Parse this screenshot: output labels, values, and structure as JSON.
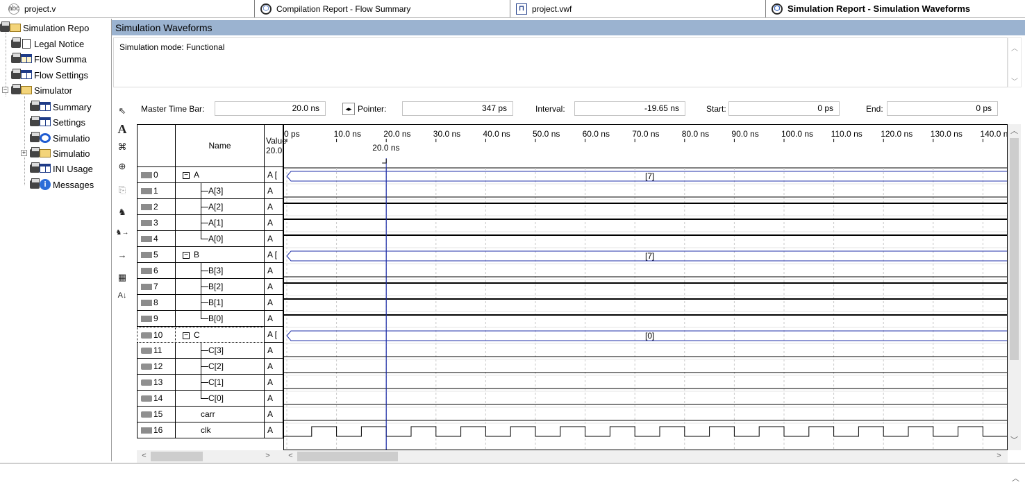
{
  "tabs": [
    {
      "label": "project.v",
      "icon": "abc-file-icon",
      "active": false
    },
    {
      "label": "Compilation Report - Flow Summary",
      "icon": "report-icon",
      "active": false
    },
    {
      "label": "project.vwf",
      "icon": "waveform-file-icon",
      "active": false
    },
    {
      "label": "Simulation Report - Simulation Waveforms",
      "icon": "report-icon",
      "active": true
    }
  ],
  "navigator": {
    "items": [
      {
        "label": "Simulation Repo"
      },
      {
        "label": "Legal Notice"
      },
      {
        "label": "Flow Summa"
      },
      {
        "label": "Flow Settings"
      },
      {
        "label": "Simulator"
      },
      {
        "label": "Summary"
      },
      {
        "label": "Settings"
      },
      {
        "label": "Simulatio"
      },
      {
        "label": "Simulatio"
      },
      {
        "label": "INI Usage"
      },
      {
        "label": "Messages"
      }
    ]
  },
  "panel": {
    "title": "Simulation Waveforms",
    "mode_text": "Simulation mode: Functional"
  },
  "timebar": {
    "master_label": "Master Time Bar:",
    "master_value": "20.0 ns",
    "pointer_label": "Pointer:",
    "pointer_value": "347 ps",
    "interval_label": "Interval:",
    "interval_value": "-19.65 ns",
    "start_label": "Start:",
    "start_value": "0 ps",
    "end_label": "End:",
    "end_value": "0 ps"
  },
  "columns": {
    "name": "Name",
    "value": "Value",
    "value_sub": "20.0"
  },
  "time_axis": {
    "ticks": [
      "0 ps",
      "10.0 ns",
      "20.0 ns",
      "30.0 ns",
      "40.0 ns",
      "50.0 ns",
      "60.0 ns",
      "70.0 ns",
      "80.0 ns",
      "90.0 ns",
      "100.0 ns",
      "110.0 ns",
      "120.0 ns",
      "130.0 ns",
      "140.0 ns"
    ],
    "marker_label": "20.0 ns",
    "marker_time_ns": 20,
    "ns_per_tick": 10
  },
  "signals": [
    {
      "index": "0",
      "name": "A",
      "value": "A [",
      "kind": "in",
      "group": true,
      "wave": "bus",
      "bus_label": "[7]"
    },
    {
      "index": "1",
      "name": "A[3]",
      "value": "A",
      "kind": "in",
      "child": true,
      "wave": "low"
    },
    {
      "index": "2",
      "name": "A[2]",
      "value": "A",
      "kind": "in",
      "child": true,
      "wave": "high"
    },
    {
      "index": "3",
      "name": "A[1]",
      "value": "A",
      "kind": "in",
      "child": true,
      "wave": "high"
    },
    {
      "index": "4",
      "name": "A[0]",
      "value": "A",
      "kind": "in",
      "child": true,
      "last": true,
      "wave": "high"
    },
    {
      "index": "5",
      "name": "B",
      "value": "A [",
      "kind": "in",
      "group": true,
      "wave": "bus",
      "bus_label": "[7]"
    },
    {
      "index": "6",
      "name": "B[3]",
      "value": "A",
      "kind": "in",
      "child": true,
      "wave": "low"
    },
    {
      "index": "7",
      "name": "B[2]",
      "value": "A",
      "kind": "in",
      "child": true,
      "wave": "high"
    },
    {
      "index": "8",
      "name": "B[1]",
      "value": "A",
      "kind": "in",
      "child": true,
      "wave": "high"
    },
    {
      "index": "9",
      "name": "B[0]",
      "value": "A",
      "kind": "in",
      "child": true,
      "last": true,
      "wave": "high"
    },
    {
      "index": "10",
      "name": "C",
      "value": "A [",
      "kind": "out",
      "group": true,
      "wave": "bus",
      "bus_label": "[0]"
    },
    {
      "index": "11",
      "name": "C[3]",
      "value": "A",
      "kind": "out",
      "child": true,
      "wave": "low"
    },
    {
      "index": "12",
      "name": "C[2]",
      "value": "A",
      "kind": "out",
      "child": true,
      "wave": "low"
    },
    {
      "index": "13",
      "name": "C[1]",
      "value": "A",
      "kind": "out",
      "child": true,
      "wave": "low"
    },
    {
      "index": "14",
      "name": "C[0]",
      "value": "A",
      "kind": "out",
      "child": true,
      "last": true,
      "wave": "low"
    },
    {
      "index": "15",
      "name": "carr",
      "value": "A",
      "kind": "out",
      "wave": "low"
    },
    {
      "index": "16",
      "name": "clk",
      "value": "A",
      "kind": "in",
      "wave": "clock",
      "clock_period_ns": 10
    }
  ],
  "colors": {
    "title_bar": "#9bb3d0",
    "bus_line": "#1f2fa8",
    "cursor": "#1f2fa8",
    "grid_dash": "#c8c8c8"
  }
}
